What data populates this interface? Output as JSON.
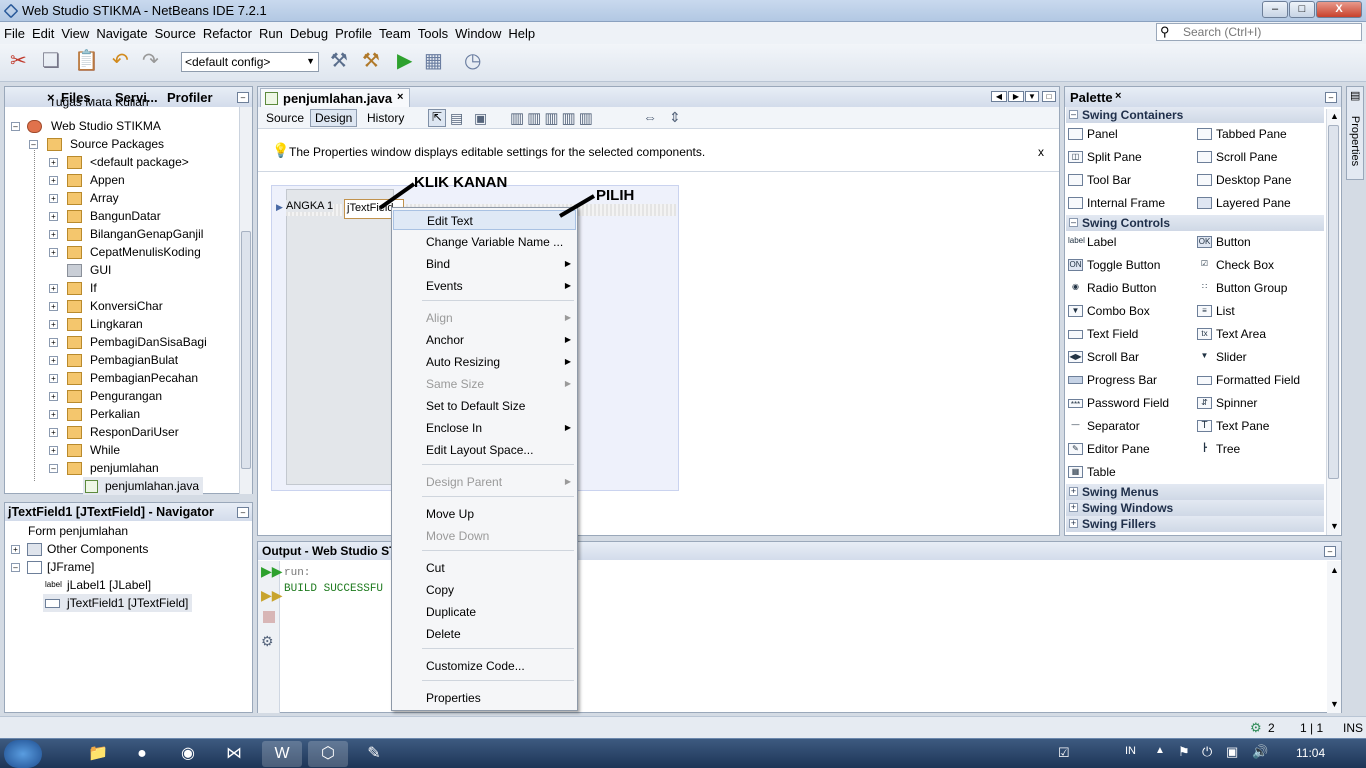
{
  "window": {
    "title": "Web Studio STIKMA - NetBeans IDE 7.2.1",
    "min": "–",
    "max": "□",
    "close": "X"
  },
  "menu": [
    "File",
    "Edit",
    "View",
    "Navigate",
    "Source",
    "Refactor",
    "Run",
    "Debug",
    "Profile",
    "Team",
    "Tools",
    "Window",
    "Help"
  ],
  "search": {
    "placeholder": "Search (Ctrl+I)"
  },
  "toolbar": {
    "config": "<default config>"
  },
  "projects": {
    "tabs": [
      "Files",
      "Servi...",
      "Profiler"
    ],
    "rows": [
      "Tugas Mata Kuliah",
      "Web Studio STIKMA",
      "Source Packages",
      "<default package>",
      "Appen",
      "Array",
      "BangunDatar",
      "BilanganGenapGanjil",
      "CepatMenulisKoding",
      "GUI",
      "If",
      "KonversiChar",
      "Lingkaran",
      "PembagiDanSisaBagi",
      "PembagianBulat",
      "PembagianPecahan",
      "Pengurangan",
      "Perkalian",
      "ResponDariUser",
      "While",
      "penjumlahan",
      "penjumlahan.java"
    ]
  },
  "navigator": {
    "title": "jTextField1 [JTextField] - Navigator",
    "rows": [
      "Form penjumlahan",
      "Other Components",
      "[JFrame]",
      "jLabel1 [JLabel]",
      "jTextField1 [JTextField]"
    ]
  },
  "editor": {
    "file_tab": "penjumlahan.java",
    "views": [
      "Source",
      "Design",
      "History"
    ],
    "info": "The Properties window displays editable settings for the selected components.",
    "info_close": "x",
    "label_text": "ANGKA 1",
    "field_text": "jTextField"
  },
  "callouts": {
    "right_click": "KLIK KANAN",
    "choose": "PILIH"
  },
  "context_menu": [
    {
      "label": "Edit Text",
      "state": "selected"
    },
    {
      "label": "Change Variable Name ...",
      "state": "enabled"
    },
    {
      "label": "Bind",
      "state": "submenu"
    },
    {
      "label": "Events",
      "state": "submenu"
    },
    {
      "label": "Align",
      "state": "disabled-submenu"
    },
    {
      "label": "Anchor",
      "state": "submenu"
    },
    {
      "label": "Auto Resizing",
      "state": "submenu"
    },
    {
      "label": "Same Size",
      "state": "disabled-submenu"
    },
    {
      "label": "Set to Default Size",
      "state": "enabled"
    },
    {
      "label": "Enclose In",
      "state": "submenu"
    },
    {
      "label": "Edit Layout Space...",
      "state": "enabled"
    },
    {
      "label": "Design Parent",
      "state": "disabled-submenu"
    },
    {
      "label": "Move Up",
      "state": "enabled"
    },
    {
      "label": "Move Down",
      "state": "disabled"
    },
    {
      "label": "Cut",
      "state": "enabled"
    },
    {
      "label": "Copy",
      "state": "enabled"
    },
    {
      "label": "Duplicate",
      "state": "enabled"
    },
    {
      "label": "Delete",
      "state": "enabled"
    },
    {
      "label": "Customize Code...",
      "state": "enabled"
    },
    {
      "label": "Properties",
      "state": "enabled"
    }
  ],
  "output": {
    "title": "Output - Web Studio STI",
    "run": "run:",
    "build": "BUILD SUCCESSFU"
  },
  "palette": {
    "title": "Palette",
    "side_tab": "Properties",
    "containers_header": "Swing Containers",
    "containers": [
      "Panel",
      "Tabbed Pane",
      "Split Pane",
      "Scroll Pane",
      "Tool Bar",
      "Desktop Pane",
      "Internal Frame",
      "Layered Pane"
    ],
    "controls_header": "Swing Controls",
    "controls": [
      "Label",
      "Button",
      "Toggle Button",
      "Check Box",
      "Radio Button",
      "Button Group",
      "Combo Box",
      "List",
      "Text Field",
      "Text Area",
      "Scroll Bar",
      "Slider",
      "Progress Bar",
      "Formatted Field",
      "Password Field",
      "Spinner",
      "Separator",
      "Text Pane",
      "Editor Pane",
      "Tree",
      "Table"
    ],
    "collapsed": [
      "Swing Menus",
      "Swing Windows",
      "Swing Fillers"
    ]
  },
  "statusbar": {
    "notifications": "2",
    "position": "1 | 1",
    "mode": "INS"
  },
  "taskbar": {
    "lang": "IN",
    "time": "11:04"
  },
  "colors": {
    "accent": "#2a5a9a",
    "callout_text": "#000000",
    "build_text": "#1e7a1e"
  }
}
